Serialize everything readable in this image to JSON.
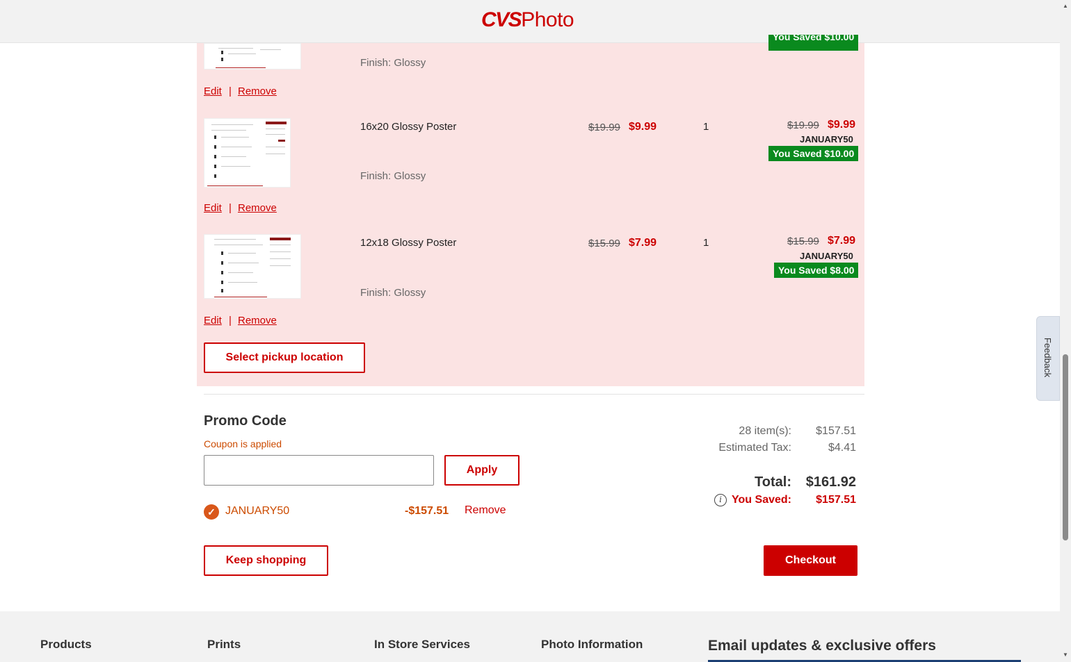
{
  "header": {
    "logo_cvs": "CVS",
    "logo_photo": "Photo"
  },
  "feedback": {
    "label": "Feedback"
  },
  "cart": {
    "partial_item": {
      "finish": "Finish: Glossy",
      "saved": "You Saved $10.00"
    },
    "items": [
      {
        "name": "16x20 Glossy Poster",
        "finish": "Finish: Glossy",
        "old_price": "$19.99",
        "new_price": "$9.99",
        "qty": "1",
        "total_old": "$19.99",
        "total_new": "$9.99",
        "promo": "JANUARY50",
        "saved": "You Saved $10.00"
      },
      {
        "name": "12x18 Glossy Poster",
        "finish": "Finish: Glossy",
        "old_price": "$15.99",
        "new_price": "$7.99",
        "qty": "1",
        "total_old": "$15.99",
        "total_new": "$7.99",
        "promo": "JANUARY50",
        "saved": "You Saved $8.00"
      }
    ],
    "edit_label": "Edit",
    "separator": "|",
    "remove_label": "Remove",
    "pickup_button": "Select pickup location"
  },
  "promo": {
    "title": "Promo Code",
    "status": "Coupon is applied",
    "input_value": "",
    "apply_button": "Apply",
    "applied_code": "JANUARY50",
    "applied_amount": "-$157.51",
    "remove_label": "Remove"
  },
  "summary": {
    "items_label": "28 item(s):",
    "items_value": "$157.51",
    "tax_label": "Estimated Tax:",
    "tax_value": "$4.41",
    "total_label": "Total:",
    "total_value": "$161.92",
    "saved_label": "You Saved:",
    "saved_value": "$157.51"
  },
  "actions": {
    "keep_shopping": "Keep shopping",
    "checkout": "Checkout"
  },
  "footer": {
    "columns": [
      "Products",
      "Prints",
      "In Store Services",
      "Photo Information"
    ],
    "email_heading": "Email updates & exclusive offers"
  },
  "colors": {
    "brand_red": "#cc0000",
    "saved_green": "#0a8a1e",
    "panel_pink": "#fbe3e3",
    "coupon_orange": "#cc4b00"
  }
}
